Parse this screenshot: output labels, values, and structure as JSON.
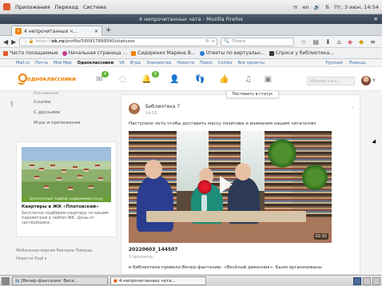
{
  "system_bar": {
    "menu": [
      "Приложения",
      "Переход",
      "Система"
    ],
    "keyboard": "en",
    "datetime": "Пт, 3 июн, 14:54"
  },
  "window": {
    "title": "4 непрочитанных чата - Mozilla Firefox"
  },
  "tab": {
    "label": "4 непрочитанных ч...",
    "new_tab": "+"
  },
  "navbar": {
    "url_secure": "https://",
    "url_host": "ok.ru",
    "url_path": "/profile/590917899540/statuses",
    "search_placeholder": "Поиск"
  },
  "bookmarks": [
    {
      "label": "Часто посещаемые",
      "color": "#e35b2e"
    },
    {
      "label": "Начальная страница ...",
      "color": "#c23b8e"
    },
    {
      "label": "Сидоренко Марина В...",
      "color": "#ee8208"
    },
    {
      "label": "Ответы по виртуальн...",
      "color": "#2b7bd1"
    },
    {
      "label": "Спроси у библиотека...",
      "color": "#3a3a3a"
    }
  ],
  "ok_topnav": {
    "items": [
      "Mail.ru",
      "Почта",
      "Мой Мир",
      "Одноклассники",
      "VK",
      "Игры",
      "Знакомства",
      "Новости",
      "Поиск",
      "Combo",
      "Все проекты"
    ],
    "active": "Одноклассники",
    "language": "Русский",
    "help": "Помощь"
  },
  "ok_header": {
    "logo": "одноклассники",
    "badges": {
      "messages": "4",
      "notifications": "6"
    },
    "search_placeholder": "Искать на с...",
    "tooltip": "Поставить в статус"
  },
  "left_menu": [
    "Реклаьные",
    "Ссылки",
    "С друзьями",
    "Игры и приложения"
  ],
  "ad": {
    "image_banner": "Бесплатный подбор недвижимости.ру",
    "title": "Квартиры в ЖК «Платовский»",
    "description": "Бесплатно подберем квартиру по вашим параметрам в любом ЖК. Цены от застройщика."
  },
  "footer": {
    "line1": "Мобильная версия  Реклама  Помощь",
    "line2": "Новости  Ещё ▾"
  },
  "post": {
    "author": "Библиотека 7",
    "time": "14:53",
    "text": "Наступило лето,чтобы доставить массу позитива и внимания нашим читателям",
    "video_duration": "02:32",
    "video_title": "20220603_144507",
    "views": "1 просмотр",
    "description": "в библиотеке провели Вечер-фантазию: «Весёлый девичник». Были организованы"
  },
  "taskbar": {
    "items": [
      "[Вечер-фантазия: Весе...",
      "4 непрочитанных чата..."
    ],
    "active_index": 1
  }
}
